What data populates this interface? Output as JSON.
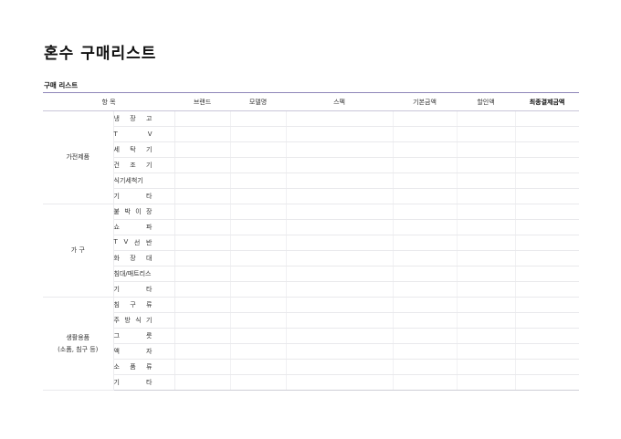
{
  "page": {
    "title": "혼수 구매리스트",
    "subtitle": "구매 리스트"
  },
  "table": {
    "headers": [
      "항 목",
      "브랜드",
      "모델명",
      "스펙",
      "기본금액",
      "할인액",
      "최종결제금액"
    ],
    "groups": [
      {
        "name": "가전제품",
        "items": [
          "냉 장 고",
          "T V",
          "세 탁 기",
          "건 조 기",
          "식기세척기",
          "기 타"
        ]
      },
      {
        "name": "가 구",
        "items": [
          "붙 박 이 장",
          "쇼 파",
          "T V 선 반",
          "화 장 대",
          "침대/매트리스",
          "기 타"
        ]
      },
      {
        "name": "생활용품",
        "name_sub": "(소품, 침구 등)",
        "items": [
          "침 구 류",
          "주 방 식 기",
          "그 릇",
          "액 자",
          "소 품 류",
          "기 타"
        ]
      }
    ]
  }
}
